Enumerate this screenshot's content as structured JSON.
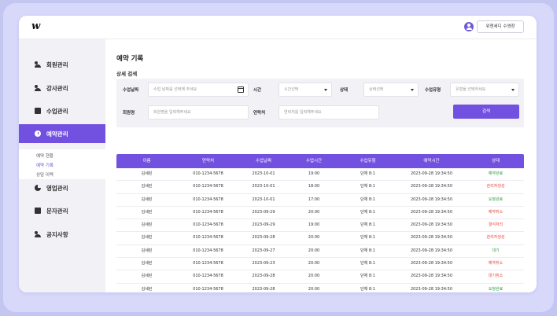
{
  "header": {
    "logo": "w",
    "user_button": "위젠세디 수영장"
  },
  "sidebar": {
    "items": [
      {
        "label": "회원관리"
      },
      {
        "label": "강사관리"
      },
      {
        "label": "수업관리"
      },
      {
        "label": "예약관리"
      },
      {
        "label": "영업관리"
      },
      {
        "label": "문자관리"
      },
      {
        "label": "공지사항"
      }
    ],
    "sub_items": [
      {
        "label": "예약 현황"
      },
      {
        "label": "예약 기록"
      },
      {
        "label": "상담 이력"
      }
    ]
  },
  "main": {
    "title": "예약 기록",
    "filter_title": "상세 검색",
    "filters": {
      "date_label": "수업날짜",
      "date_placeholder": "수업 날짜를 선택해 주세요",
      "time_label": "시간",
      "time_value": "시간선택",
      "status_label": "상태",
      "status_value": "상태선택",
      "type_label": "수업유형",
      "type_value": "유형을 선택하세요",
      "name_label": "회원명",
      "name_placeholder": "회원명을 입력해주세요",
      "contact_label": "연락처",
      "contact_placeholder": "연락처를 입력해주세요",
      "search_button": "검색"
    },
    "table": {
      "headers": [
        "이름",
        "연락처",
        "수업날짜",
        "수업시간",
        "수업유형",
        "예약시간",
        "상태"
      ],
      "rows": [
        [
          "김세린",
          "010-1234-5678",
          "2023-10-01",
          "19:00",
          "단체 8:1",
          "2023-09-28 19:34:50",
          "예약완료"
        ],
        [
          "김세린",
          "010-1234-5678",
          "2023-10-01",
          "18:00",
          "단체 8:1",
          "2023-09-28 19:34:50",
          "관리자생성"
        ],
        [
          "김세린",
          "010-1234-5678",
          "2023-10-01",
          "17:00",
          "단체 8:1",
          "2023-09-28 19:34:50",
          "요청완료"
        ],
        [
          "김세린",
          "010-1234-5678",
          "2023-09-29",
          "20:00",
          "단체 8:1",
          "2023-09-28 19:34:50",
          "예약취소"
        ],
        [
          "김세린",
          "010-1234-5678",
          "2023-09-29",
          "19:00",
          "단체 8:1",
          "2023-09-28 19:34:50",
          "결석처리"
        ],
        [
          "김세린",
          "010-1234-5678",
          "2023-09-28",
          "20:00",
          "단체 8:1",
          "2023-09-28 19:34:50",
          "관리자생성"
        ],
        [
          "김세린",
          "010-1234-5678",
          "2023-09-27",
          "20:00",
          "단체 8:1",
          "2023-09-28 19:34:50",
          "대기"
        ],
        [
          "김세린",
          "010-1234-5678",
          "2023-09-23",
          "20:00",
          "단체 8:1",
          "2023-09-28 19:34:50",
          "예약취소"
        ],
        [
          "김세린",
          "010-1234-5678",
          "2023-09-28",
          "20:00",
          "단체 8:1",
          "2023-09-28 19:34:50",
          "대기취소"
        ],
        [
          "김세린",
          "010-1234-5678",
          "2023-09-28",
          "20:00",
          "단체 8:1",
          "2023-09-28 19:34:50",
          "요청완료"
        ]
      ]
    }
  },
  "colors": {
    "accent": "#7351e0",
    "status_green": "#2e9a3e",
    "status_red": "#e0483e",
    "status_blue": "#2f6fd6"
  },
  "icons": [
    "user-avatar-icon",
    "calendar-icon",
    "chevron-down-icon"
  ]
}
